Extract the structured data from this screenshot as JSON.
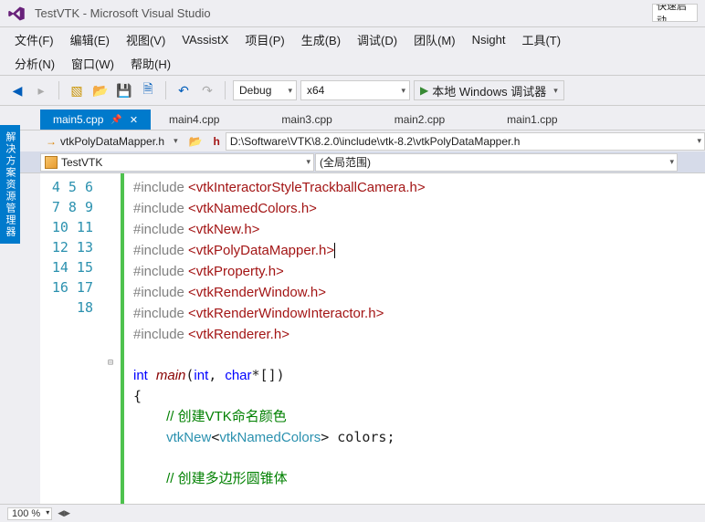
{
  "title": "TestVTK - Microsoft Visual Studio",
  "quick_placeholder": "快速启动",
  "menu": [
    "文件(F)",
    "编辑(E)",
    "视图(V)",
    "VAssistX",
    "项目(P)",
    "生成(B)",
    "调试(D)",
    "团队(M)",
    "Nsight",
    "工具(T)"
  ],
  "menu2": [
    "分析(N)",
    "窗口(W)",
    "帮助(H)"
  ],
  "config": {
    "mode": "Debug",
    "platform": "x64",
    "run": "本地 Windows 调试器"
  },
  "tabs": [
    {
      "label": "main5.cpp",
      "active": true
    },
    {
      "label": "main4.cpp"
    },
    {
      "label": "main3.cpp"
    },
    {
      "label": "main2.cpp"
    },
    {
      "label": "main1.cpp"
    }
  ],
  "sidetab": "解决方案资源管理器",
  "breadcrumb": {
    "file": "vtkPolyDataMapper.h",
    "path_prefix": "h",
    "path": "D:\\Software\\VTK\\8.2.0\\include\\vtk-8.2\\vtkPolyDataMapper.h"
  },
  "nav": {
    "scope": "TestVTK",
    "symbol": "(全局范围)"
  },
  "code_lines": [
    {
      "n": 4,
      "t": "include",
      "h": "vtkInteractorStyleTrackballCamera.h"
    },
    {
      "n": 5,
      "t": "include",
      "h": "vtkNamedColors.h"
    },
    {
      "n": 6,
      "t": "include",
      "h": "vtkNew.h"
    },
    {
      "n": 7,
      "t": "include",
      "h": "vtkPolyDataMapper.h",
      "caret": true
    },
    {
      "n": 8,
      "t": "include",
      "h": "vtkProperty.h"
    },
    {
      "n": 9,
      "t": "include",
      "h": "vtkRenderWindow.h"
    },
    {
      "n": 10,
      "t": "include",
      "h": "vtkRenderWindowInteractor.h"
    },
    {
      "n": 11,
      "t": "include",
      "h": "vtkRenderer.h"
    },
    {
      "n": 12,
      "t": "blank"
    },
    {
      "n": 13,
      "t": "main",
      "fold": true
    },
    {
      "n": 14,
      "t": "brace_open"
    },
    {
      "n": 15,
      "t": "comment",
      "text": "// 创建VTK命名颜色"
    },
    {
      "n": 16,
      "t": "decl"
    },
    {
      "n": 17,
      "t": "blank"
    },
    {
      "n": 18,
      "t": "comment",
      "text": "// 创建多边形圆锥体"
    }
  ],
  "zoom": "100 %"
}
